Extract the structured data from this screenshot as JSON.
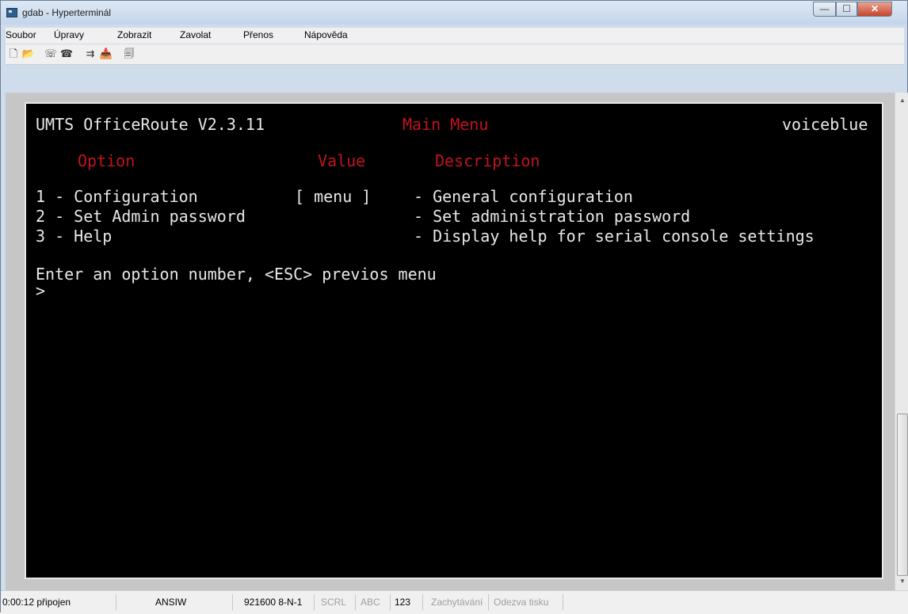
{
  "window": {
    "title": "gdab - Hyperterminál"
  },
  "menu": [
    "Soubor",
    "Úpravy",
    "Zobrazit",
    "Zavolat",
    "Přenos",
    "Nápověda"
  ],
  "toolbar": [
    {
      "name": "new-icon",
      "glyph": "🗋"
    },
    {
      "name": "open-icon",
      "glyph": "📂"
    },
    {
      "name": "connect-icon",
      "glyph": "☏"
    },
    {
      "name": "disconnect-icon",
      "glyph": "☎"
    },
    {
      "name": "send-icon",
      "glyph": "⇉"
    },
    {
      "name": "receive-icon",
      "glyph": "📥"
    },
    {
      "name": "properties-icon",
      "glyph": "🗐"
    }
  ],
  "terminal": {
    "header_product": "UMTS OfficeRoute V2.3.11",
    "header_menu": "Main Menu",
    "header_user": "voiceblue",
    "col_option": "Option",
    "col_value": "Value",
    "col_description": "Description",
    "rows": [
      {
        "option": "1 - Configuration",
        "value": "[ menu ]",
        "desc": "- General configuration"
      },
      {
        "option": "2 - Set Admin password",
        "value": "",
        "desc": "- Set administration password"
      },
      {
        "option": "3 - Help",
        "value": "",
        "desc": "- Display help for serial console settings"
      }
    ],
    "prompt": "Enter an option number, <ESC> previos menu",
    "cursor": ">"
  },
  "status": {
    "connected": "0:00:12 připojen",
    "emulation": "ANSIW",
    "port": "921600 8-N-1",
    "scrl": "SCRL",
    "abc": "ABC",
    "num": "123",
    "capture": "Zachytávání",
    "print": "Odezva tisku"
  },
  "colors": {
    "terminal_bg": "#000000",
    "terminal_text": "#e8e8e8",
    "terminal_accent": "#c0141d"
  }
}
